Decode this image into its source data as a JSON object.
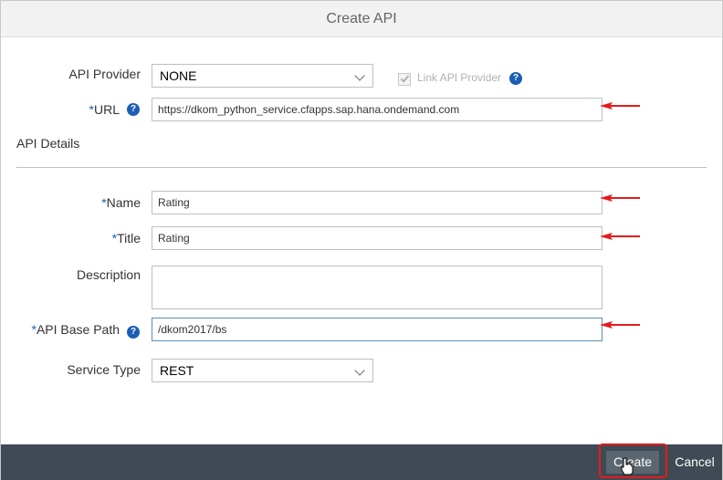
{
  "dialog": {
    "title": "Create API"
  },
  "form": {
    "api_provider": {
      "label": "API Provider",
      "value": "NONE"
    },
    "link_api_provider": {
      "label": "Link API Provider",
      "checked": true,
      "disabled": true
    },
    "url": {
      "required_mark": "*",
      "label": "URL",
      "value": "https://dkom_python_service.cfapps.sap.hana.ondemand.com"
    },
    "section_title": "API Details",
    "name": {
      "required_mark": "*",
      "label": "Name",
      "value": "Rating"
    },
    "title": {
      "required_mark": "*",
      "label": "Title",
      "value": "Rating"
    },
    "description": {
      "label": "Description",
      "value": ""
    },
    "api_base_path": {
      "required_mark": "*",
      "label": "API Base Path",
      "value": "/dkom2017/bs"
    },
    "service_type": {
      "label": "Service Type",
      "value": "REST"
    },
    "help_glyph": "?"
  },
  "footer": {
    "create_label": "Create",
    "cancel_label": "Cancel"
  },
  "colors": {
    "annotation_red": "#e31b1b",
    "footer_bg": "#3f4a54",
    "help_blue": "#1a5fb4"
  }
}
